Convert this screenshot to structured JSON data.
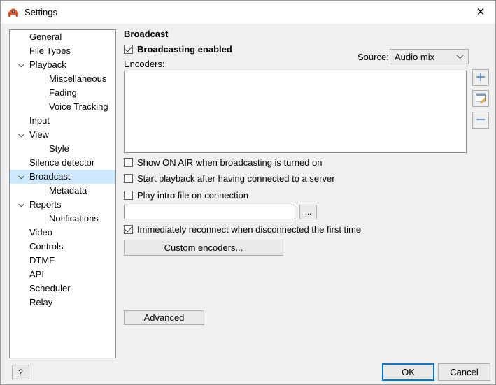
{
  "window": {
    "title": "Settings",
    "app_icon": "headphones-icon",
    "close_icon": "close-icon",
    "background_color": "#f0f0f0",
    "titlebar_color": "#ffffff"
  },
  "sidebar": {
    "name": "settings-tree",
    "selection_color": "#cde8ff",
    "items": [
      {
        "label": "General",
        "depth": 0,
        "chevron": "",
        "selected": false
      },
      {
        "label": "File Types",
        "depth": 0,
        "chevron": "",
        "selected": false
      },
      {
        "label": "Playback",
        "depth": 0,
        "chevron": "chevron-down",
        "selected": false
      },
      {
        "label": "Miscellaneous",
        "depth": 1,
        "chevron": "",
        "selected": false
      },
      {
        "label": "Fading",
        "depth": 1,
        "chevron": "",
        "selected": false
      },
      {
        "label": "Voice Tracking",
        "depth": 1,
        "chevron": "",
        "selected": false
      },
      {
        "label": "Input",
        "depth": 0,
        "chevron": "",
        "selected": false
      },
      {
        "label": "View",
        "depth": 0,
        "chevron": "chevron-down",
        "selected": false
      },
      {
        "label": "Style",
        "depth": 1,
        "chevron": "",
        "selected": false
      },
      {
        "label": "Silence detector",
        "depth": 0,
        "chevron": "",
        "selected": false
      },
      {
        "label": "Broadcast",
        "depth": 0,
        "chevron": "chevron-down",
        "selected": true
      },
      {
        "label": "Metadata",
        "depth": 1,
        "chevron": "",
        "selected": false
      },
      {
        "label": "Reports",
        "depth": 0,
        "chevron": "chevron-down",
        "selected": false
      },
      {
        "label": "Notifications",
        "depth": 1,
        "chevron": "",
        "selected": false
      },
      {
        "label": "Video",
        "depth": 0,
        "chevron": "",
        "selected": false
      },
      {
        "label": "Controls",
        "depth": 0,
        "chevron": "",
        "selected": false
      },
      {
        "label": "DTMF",
        "depth": 0,
        "chevron": "",
        "selected": false
      },
      {
        "label": "API",
        "depth": 0,
        "chevron": "",
        "selected": false
      },
      {
        "label": "Scheduler",
        "depth": 0,
        "chevron": "",
        "selected": false
      },
      {
        "label": "Relay",
        "depth": 0,
        "chevron": "",
        "selected": false
      }
    ]
  },
  "pane": {
    "title": "Broadcast",
    "broadcasting_enabled": {
      "label": "Broadcasting enabled",
      "checked": true
    },
    "source": {
      "label": "Source:",
      "value": "Audio mix",
      "chevron_icon": "chevron-down-icon"
    },
    "encoders": {
      "label": "Encoders:",
      "rows": [],
      "add_icon": "plus-icon",
      "edit_icon": "edit-window-pencil-icon",
      "remove_icon": "minus-icon",
      "plus_color": "#6b9bd2",
      "minus_color": "#6b9bd2"
    },
    "options": [
      {
        "label": "Show ON AIR when broadcasting is turned on",
        "checked": false
      },
      {
        "label": "Start playback after having connected to a server",
        "checked": false
      },
      {
        "label": "Play intro file on connection",
        "checked": false
      }
    ],
    "intro_file": {
      "value": "",
      "placeholder": ""
    },
    "browse_button": "...",
    "reconnect": {
      "label": "Immediately reconnect when disconnected the first time",
      "checked": true
    },
    "custom_encoders_button": "Custom encoders...",
    "advanced_button": "Advanced"
  },
  "footer": {
    "help_button": "?",
    "ok_button": "OK",
    "cancel_button": "Cancel",
    "focus_color": "#0078d7"
  }
}
